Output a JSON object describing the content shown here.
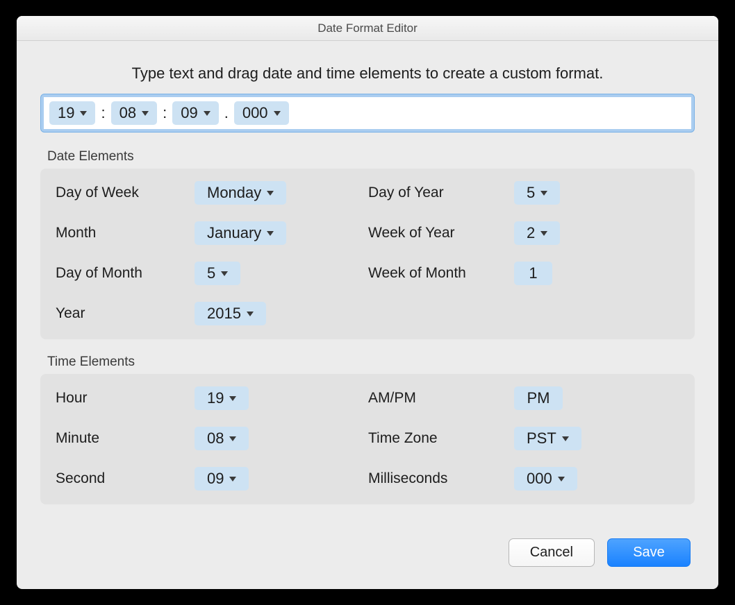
{
  "window": {
    "title": "Date Format Editor"
  },
  "instruction": "Type text and drag date and time elements to create a custom format.",
  "format_tokens": {
    "t1": "19",
    "sep1": ":",
    "t2": "08",
    "sep2": ":",
    "t3": "09",
    "sep3": ".",
    "t4": "000"
  },
  "sections": {
    "date_label": "Date Elements",
    "time_label": "Time Elements"
  },
  "date": {
    "day_of_week": {
      "label": "Day of Week",
      "value": "Monday",
      "dropdown": true
    },
    "day_of_year": {
      "label": "Day of Year",
      "value": "5",
      "dropdown": true
    },
    "month": {
      "label": "Month",
      "value": "January",
      "dropdown": true
    },
    "week_of_year": {
      "label": "Week of Year",
      "value": "2",
      "dropdown": true
    },
    "day_of_month": {
      "label": "Day of Month",
      "value": "5",
      "dropdown": true
    },
    "week_of_month": {
      "label": "Week of Month",
      "value": "1",
      "dropdown": false
    },
    "year": {
      "label": "Year",
      "value": "2015",
      "dropdown": true
    }
  },
  "time": {
    "hour": {
      "label": "Hour",
      "value": "19",
      "dropdown": true
    },
    "ampm": {
      "label": "AM/PM",
      "value": "PM",
      "dropdown": false
    },
    "minute": {
      "label": "Minute",
      "value": "08",
      "dropdown": true
    },
    "timezone": {
      "label": "Time Zone",
      "value": "PST",
      "dropdown": true
    },
    "second": {
      "label": "Second",
      "value": "09",
      "dropdown": true
    },
    "millis": {
      "label": "Milliseconds",
      "value": "000",
      "dropdown": true
    }
  },
  "buttons": {
    "cancel": "Cancel",
    "save": "Save"
  }
}
